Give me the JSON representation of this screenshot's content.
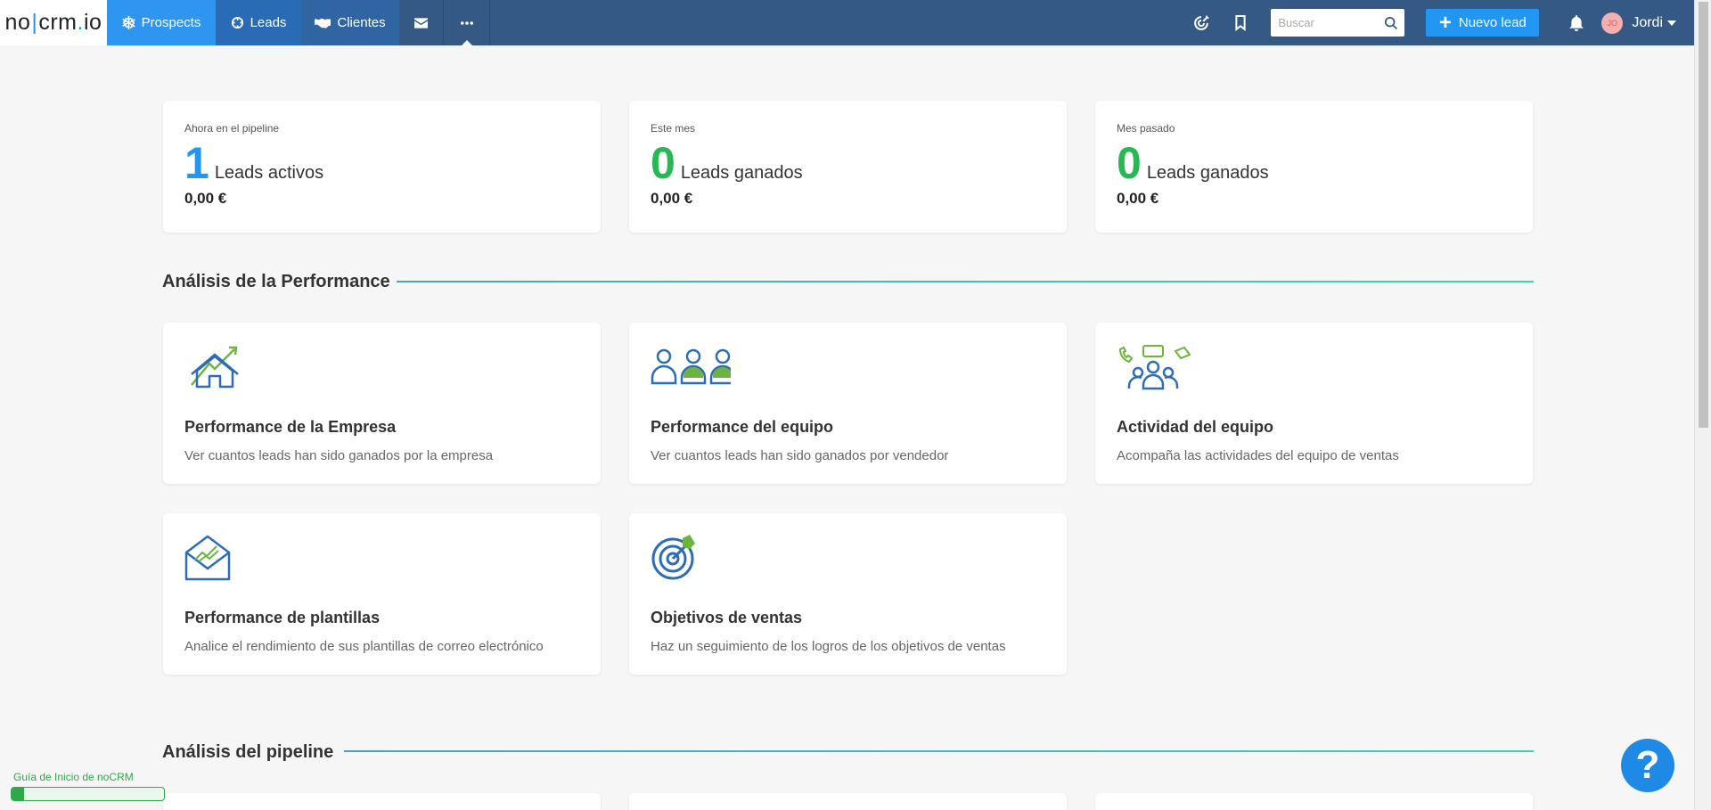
{
  "logo": {
    "part1": "no",
    "part2": "crm",
    "dot": ".",
    "part3": "io"
  },
  "nav": {
    "prospects": "Prospects",
    "leads": "Leads",
    "clientes": "Clientes"
  },
  "topbar": {
    "search_placeholder": "Buscar",
    "new_lead": "Nuevo lead",
    "avatar_initials": "JO",
    "user_name": "Jordi"
  },
  "stats": [
    {
      "label": "Ahora en el pipeline",
      "number": "1",
      "text": "Leads activos",
      "amount": "0,00 €",
      "color": "#2196f3"
    },
    {
      "label": "Este mes",
      "number": "0",
      "text": "Leads ganados",
      "amount": "0,00 €",
      "color": "#27b856"
    },
    {
      "label": "Mes pasado",
      "number": "0",
      "text": "Leads ganados",
      "amount": "0,00 €",
      "color": "#27b856"
    }
  ],
  "sections": {
    "performance": "Análisis de la Performance",
    "pipeline": "Análisis del pipeline"
  },
  "features": [
    {
      "icon": "house-growth-icon",
      "title": "Performance de la Empresa",
      "desc": "Ver cuantos leads han sido ganados por la empresa"
    },
    {
      "icon": "team-users-icon",
      "title": "Performance del equipo",
      "desc": "Ver cuantos leads han sido ganados por vendedor"
    },
    {
      "icon": "team-activity-icon",
      "title": "Actividad del equipo",
      "desc": "Acompaña las actividades del equipo de ventas"
    },
    {
      "icon": "envelope-chart-icon",
      "title": "Performance de plantillas",
      "desc": "Analice el rendimiento de sus plantillas de correo electrónico"
    },
    {
      "icon": "target-icon",
      "title": "Objetivos de ventas",
      "desc": "Haz un seguimiento de los logros de los objetivos de ventas"
    }
  ],
  "guide": {
    "label": "Guía de Inicio de noCRM",
    "progress": 0.08
  },
  "colors": {
    "brand_blue": "#2196f3",
    "topbar": "#345984",
    "green": "#27b856",
    "icon_blue": "#2d6db5",
    "icon_green": "#6cb33f"
  }
}
